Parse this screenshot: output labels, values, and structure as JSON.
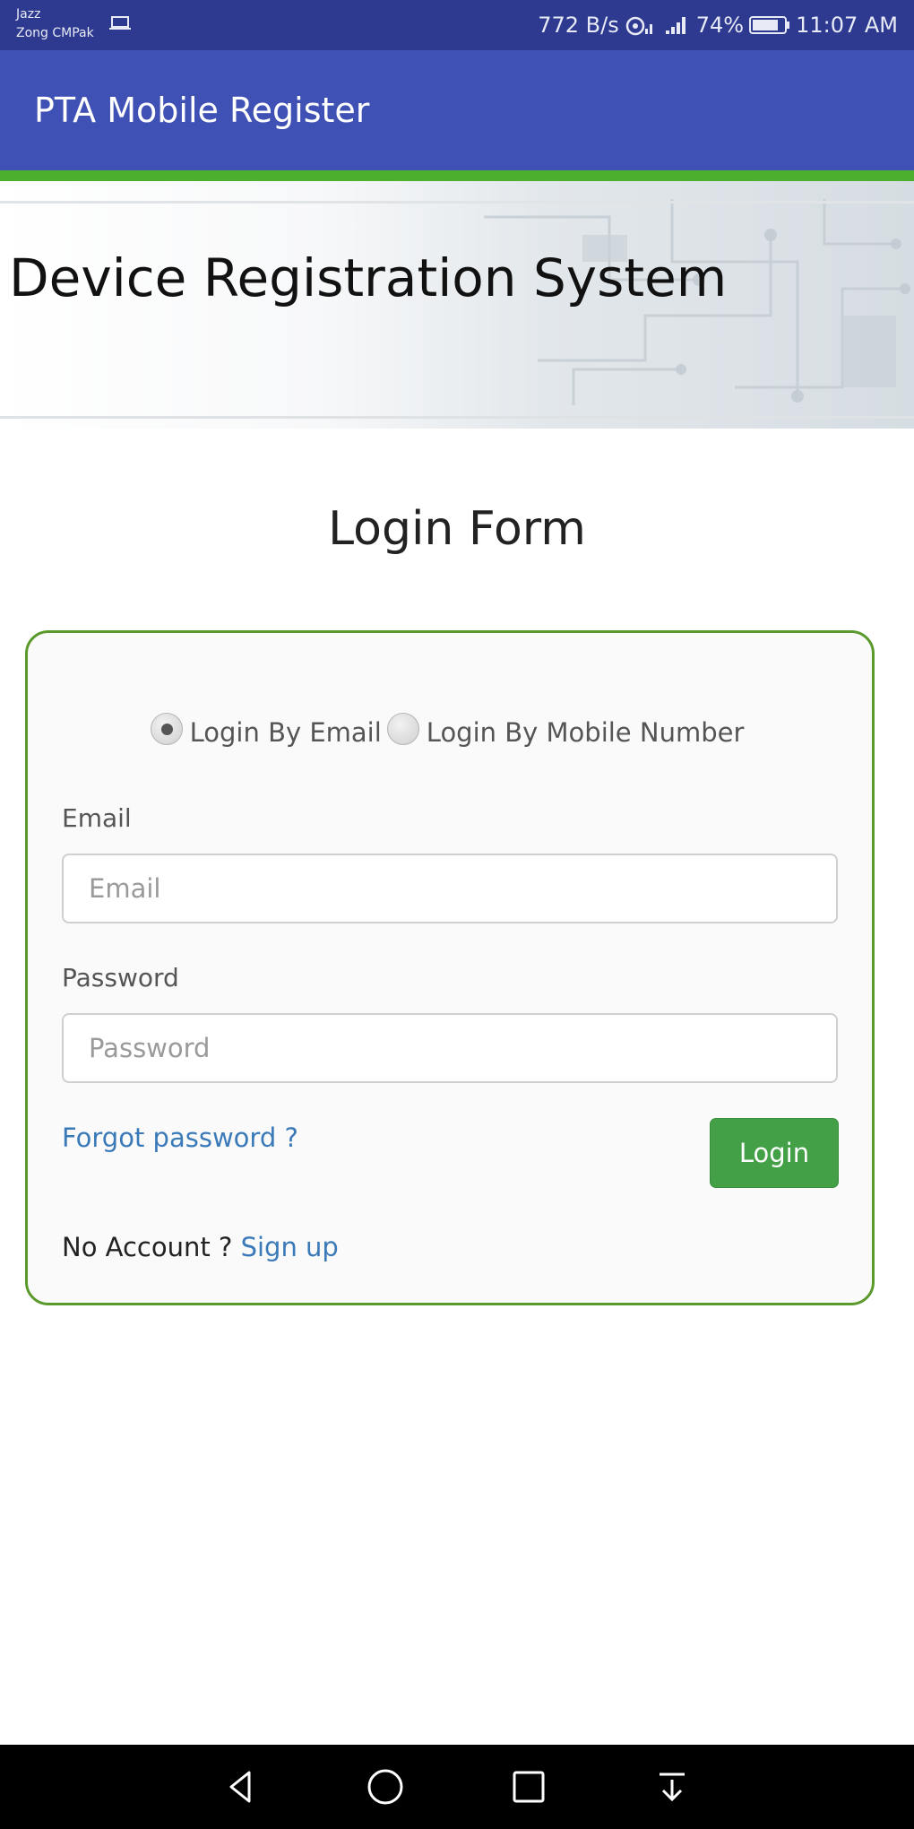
{
  "status_bar": {
    "carrier_1": "Jazz",
    "carrier_2": "Zong CMPak",
    "net_speed": "772 B/s",
    "battery_percent": "74%",
    "time": "11:07 AM",
    "icons": [
      "laptop-icon",
      "hotspot-icon",
      "signal-icon",
      "battery-icon"
    ]
  },
  "app_bar": {
    "title": "PTA Mobile Register",
    "color": "#3f51b5",
    "accent_strip": "#4caf2e"
  },
  "banner": {
    "title": "Device Registration System"
  },
  "form": {
    "title": "Login Form",
    "radio_options": [
      {
        "label": "Login By Email",
        "checked": true
      },
      {
        "label": "Login By Mobile Number",
        "checked": false
      }
    ],
    "email": {
      "label": "Email",
      "placeholder": "Email",
      "value": ""
    },
    "password": {
      "label": "Password",
      "placeholder": "Password",
      "value": ""
    },
    "forgot_password": "Forgot password ?",
    "login_button": "Login",
    "no_account": "No Account ?",
    "sign_up": "Sign up",
    "border_color": "#5a9a2c",
    "button_color": "#43a047",
    "link_color": "#3b7ab8"
  },
  "nav_bar": {
    "buttons": [
      "back-icon",
      "home-icon",
      "recents-icon",
      "notification-pull-icon"
    ]
  }
}
